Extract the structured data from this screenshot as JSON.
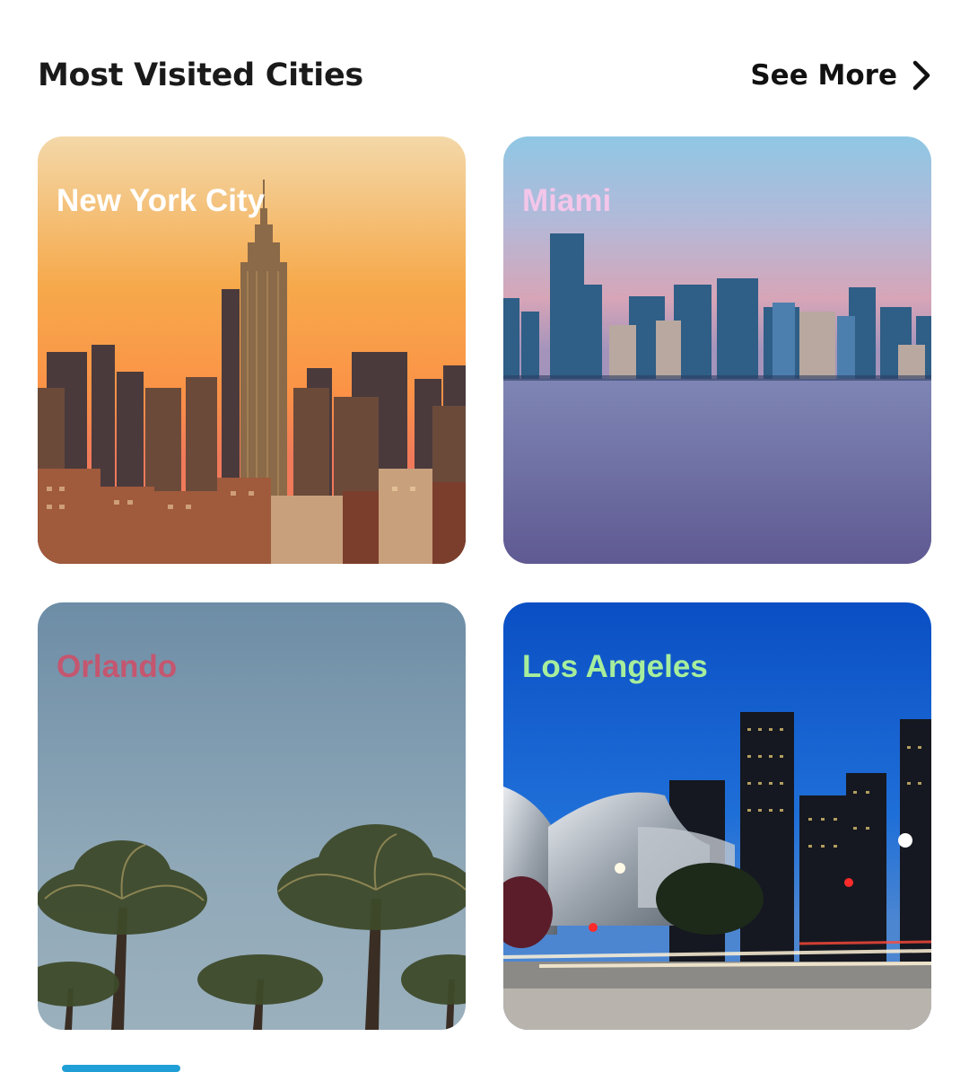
{
  "section": {
    "title": "Most Visited Cities",
    "see_more_label": "See More",
    "see_more_icon": "chevron-right-icon"
  },
  "cities": [
    {
      "name": "New York City",
      "label_color": "#ffffff"
    },
    {
      "name": "Miami",
      "label_color": "#f3c6ea"
    },
    {
      "name": "Orlando",
      "label_color": "#c4566f"
    },
    {
      "name": "Los Angeles",
      "label_color": "#a7ee9c"
    }
  ],
  "colors": {
    "indicator": "#1f9fd6"
  }
}
